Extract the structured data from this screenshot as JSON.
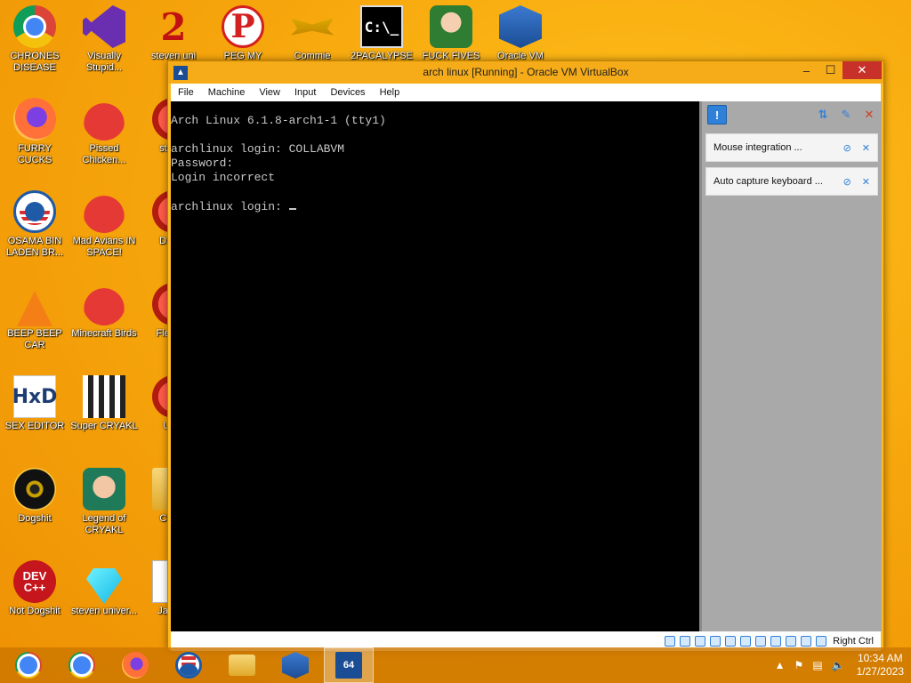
{
  "desktop": {
    "icons": [
      {
        "label": "CHRONES DISEASE"
      },
      {
        "label": "FURRY CUCKS"
      },
      {
        "label": "OSAMA BIN LADEN BR..."
      },
      {
        "label": "BEEP BEEP CAR"
      },
      {
        "label": "SEX EDITOR"
      },
      {
        "label": "Dogshit"
      },
      {
        "label": "Not Dogshit"
      },
      {
        "label": "Visually Stupid..."
      },
      {
        "label": "Pissed Chicken..."
      },
      {
        "label": "Mad Avians IN SPACE!"
      },
      {
        "label": "Minecraft Birds"
      },
      {
        "label": "Super CRYAKL"
      },
      {
        "label": "Legend of CRYAKL"
      },
      {
        "label": "steven univer..."
      },
      {
        "label": "steven uni"
      },
      {
        "label": "PEG MY WIFE!"
      },
      {
        "label": "Commie"
      },
      {
        "label": "2PACALYPSE"
      },
      {
        "label": "FUCK FIVES"
      },
      {
        "label": "Oracle VM"
      },
      {
        "label": "st univ"
      },
      {
        "label": "DarkO"
      },
      {
        "label": "Fles DE"
      },
      {
        "label": "UKR"
      },
      {
        "label": "Chi Dr"
      },
      {
        "label": "Jap Lol"
      }
    ],
    "icon_text": {
      "dev": "DEV C++",
      "hxd": "HxD",
      "cmd": "C:\\_",
      "two": "2",
      "p": "P"
    }
  },
  "window": {
    "title": "arch linux [Running] - Oracle VM VirtualBox",
    "controls": {
      "minimize": "–",
      "maximize": "☐",
      "close": "✕"
    },
    "menu": [
      "File",
      "Machine",
      "View",
      "Input",
      "Devices",
      "Help"
    ]
  },
  "terminal": {
    "lines": [
      "Arch Linux 6.1.8-arch1-1 (tty1)",
      "",
      "archlinux login: COLLABVM",
      "Password:",
      "Login incorrect",
      "",
      "archlinux login: "
    ]
  },
  "side_panel": {
    "notifications": [
      {
        "text": "Mouse integration ..."
      },
      {
        "text": "Auto capture keyboard ..."
      }
    ]
  },
  "statusbar": {
    "host_key": "Right Ctrl"
  },
  "taskbar": {
    "clock_time": "10:34 AM",
    "clock_date": "1/27/2023",
    "vbox_badge": "64"
  },
  "colors": {
    "accent": "#2f80d8",
    "close": "#c7312a",
    "desktop": "#f7a80d"
  }
}
